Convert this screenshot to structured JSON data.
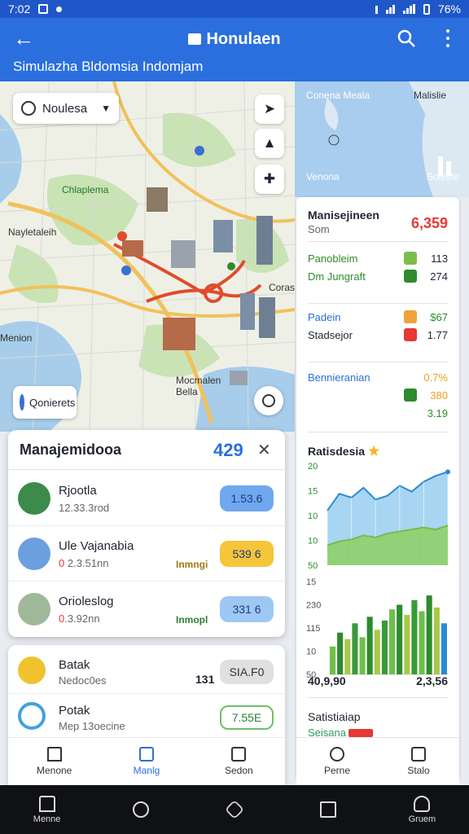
{
  "status_bar": {
    "time": "7:02",
    "battery": "76%"
  },
  "app_bar": {
    "title": "Honulaen",
    "subtitle": "Simulazha Bldomsia Indomjam"
  },
  "map": {
    "filter_chip": "Noulesa",
    "poi_chip": "Qonierets",
    "labels": [
      "Chlaplema",
      "Nayletaleih",
      "Menion",
      "Coras",
      "Mocmalen Bella"
    ]
  },
  "satellite": {
    "labels": [
      "Conena Meala",
      "Malislie",
      "Venona",
      "Soleste"
    ]
  },
  "summary_panel": {
    "title": "Manisejineen",
    "subtitle": "Som",
    "total": "6,359",
    "rows": [
      {
        "label": "Panobleim",
        "value": "113",
        "accent": "#2e8b2e"
      },
      {
        "label": "Dm Jungraft",
        "value": "274",
        "accent": "#2e8b2e"
      },
      {
        "label": "Padein",
        "value": "$67",
        "accent": "#2b6fde"
      },
      {
        "label": "Stadsejor",
        "value": "1.77",
        "accent": "#1f2430"
      },
      {
        "label": "Bennieranian",
        "value": "0.7%",
        "accent": "#2b6fde"
      },
      {
        "label": "",
        "value": "380",
        "accent": "#2e8b2e"
      },
      {
        "label": "",
        "value": "3.19",
        "accent": "#2e8b2e"
      }
    ],
    "chart_title": "Ratisdesia",
    "chart_footer_left": "40,9,90",
    "chart_footer_right": "2,3,56",
    "stats_title": "Satistiaiap",
    "stats_sub": "Seisana"
  },
  "chart_data": [
    {
      "type": "area",
      "title": "Ratisdesia",
      "y_ticks": [
        "20",
        "15",
        "10",
        "10",
        "50"
      ],
      "series": [
        {
          "values": [
            55,
            72,
            68,
            78,
            66,
            70,
            80,
            74,
            84,
            90,
            94
          ]
        },
        {
          "values": [
            20,
            24,
            26,
            30,
            28,
            32,
            34,
            36,
            38,
            36,
            40
          ]
        }
      ],
      "ylim": [
        0,
        100
      ]
    },
    {
      "type": "bar",
      "y_ticks": [
        "15",
        "230",
        "115",
        "10",
        "50"
      ],
      "values": [
        30,
        45,
        38,
        55,
        40,
        62,
        48,
        58,
        70,
        75,
        64,
        80,
        68,
        85,
        72,
        55
      ],
      "ylim": [
        0,
        100
      ]
    }
  ],
  "manage_sheet": {
    "title": "Manajemidooa",
    "count": "429",
    "items": [
      {
        "name": "Rjootla",
        "detail": "12.33.3rod",
        "detail_prefix": "",
        "tag": "",
        "pill": "1.53.6",
        "pill_color": "#6fa8ef",
        "avatar_color": "#3c8b4a"
      },
      {
        "name": "Ule Vajanabia",
        "detail": "2.3.51nn",
        "detail_prefix": "0",
        "tag": "Inmngi",
        "pill": "539 6",
        "pill_color": "#f5c53a",
        "avatar_color": "#6b9fe0"
      },
      {
        "name": "Orioleslog",
        "detail": "3.92nn",
        "detail_prefix": "0.",
        "tag": "Inmopl",
        "pill": "331 6",
        "pill_color": "#9ec8f4",
        "avatar_color": "#9fb89a"
      }
    ]
  },
  "sheet2": {
    "items": [
      {
        "name": "Batak",
        "detail": "Nedoc0es",
        "num": "131",
        "pill": "SIA.F0",
        "pill_color": "#e0e0e0",
        "avatar_color": "#f0c22e"
      },
      {
        "name": "Potak",
        "detail": "Mep 13oecine",
        "num": "",
        "pill": "7.55E",
        "pill_color": "#ffffff",
        "avatar_color": "#3fa3e0"
      }
    ]
  },
  "bottom_nav": {
    "items": [
      "Menone",
      "Manlg",
      "Sedon"
    ],
    "active": 1
  },
  "right_nav": {
    "items": [
      "Perne",
      "Stalo"
    ]
  },
  "system_nav": {
    "items": [
      "Menne",
      "",
      "",
      "",
      "Gruem"
    ]
  }
}
